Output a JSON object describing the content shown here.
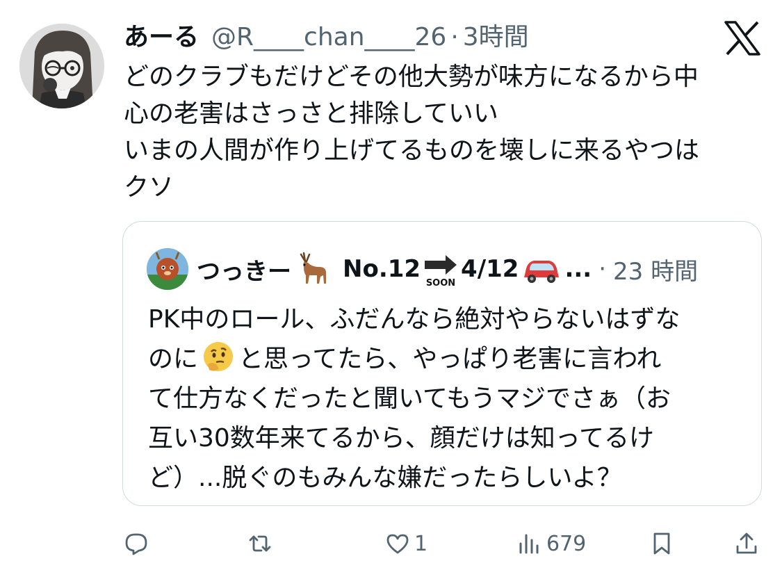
{
  "author": {
    "display_name": "あーる",
    "handle": "@R____chan____26",
    "timestamp": "3時間",
    "avatar_icon": "avatar-girl-with-glasses"
  },
  "brand": {
    "logo_icon": "x-logo-icon"
  },
  "tweet": {
    "lines": [
      "どのクラブもだけどその他大勢が味方になるから中",
      "心の老害はさっさと排除していい",
      "いまの人間が作り上げてるものを壊しに来るやつは",
      "クソ"
    ]
  },
  "quoted": {
    "display_name": "つっきー",
    "name_suffix": "No.12",
    "soon_label": "SOON",
    "date_text": "4/12",
    "ellipsis": "...",
    "timestamp": "23 時間",
    "separator": "·",
    "lines": [
      "PK中のロール、ふだんなら絶対やらないはずな",
      "と思ってたら、やっぱり老害に言われ",
      "て仕方なくだったと聞いてもうマジでさぁ（お",
      "互い30数年来てるから、顔だけは知ってるけ",
      "ど）...脱ぐのもみんな嫌だったらしいよ？"
    ],
    "line2_prefix": "のに"
  },
  "actions": {
    "reply": {
      "icon": "reply-icon",
      "count": ""
    },
    "retweet": {
      "icon": "retweet-icon",
      "count": ""
    },
    "like": {
      "icon": "heart-icon",
      "count": "1"
    },
    "views": {
      "icon": "views-icon",
      "count": "679"
    },
    "bookmark": {
      "icon": "bookmark-icon",
      "count": ""
    },
    "share": {
      "icon": "share-icon",
      "count": ""
    }
  },
  "separator": "·",
  "colors": {
    "text": "#0f1419",
    "secondary": "#536471",
    "border": "#cfd9de"
  }
}
